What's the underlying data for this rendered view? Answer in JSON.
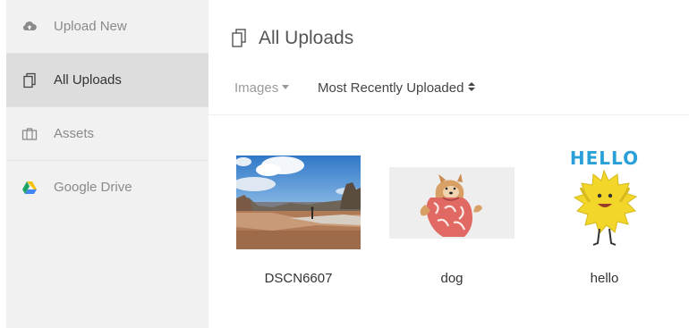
{
  "sidebar": {
    "items": [
      {
        "label": "Upload New",
        "icon": "cloud-upload-icon",
        "active": false
      },
      {
        "label": "All Uploads",
        "icon": "files-icon",
        "active": true
      },
      {
        "label": "Assets",
        "icon": "briefcase-icon",
        "active": false
      },
      {
        "label": "Google Drive",
        "icon": "google-drive-icon",
        "active": false
      }
    ]
  },
  "header": {
    "title": "All Uploads",
    "title_icon": "files-icon"
  },
  "filters": {
    "type_filter": "Images",
    "sort_label": "Most Recently Uploaded"
  },
  "uploads": [
    {
      "name": "DSCN6607",
      "kind": "photo-desert-landscape"
    },
    {
      "name": "dog",
      "kind": "photo-dog-in-blanket"
    },
    {
      "name": "hello",
      "kind": "sticker-sun-character",
      "sticker_text": "HELLO"
    }
  ],
  "colors": {
    "sidebar_bg": "#f1f1f1",
    "sidebar_active_bg": "#dddddd",
    "text_muted": "#8a8a8a",
    "text_dark": "#333333",
    "hello_blue": "#2a9fd8",
    "sun_yellow": "#f2d629"
  }
}
